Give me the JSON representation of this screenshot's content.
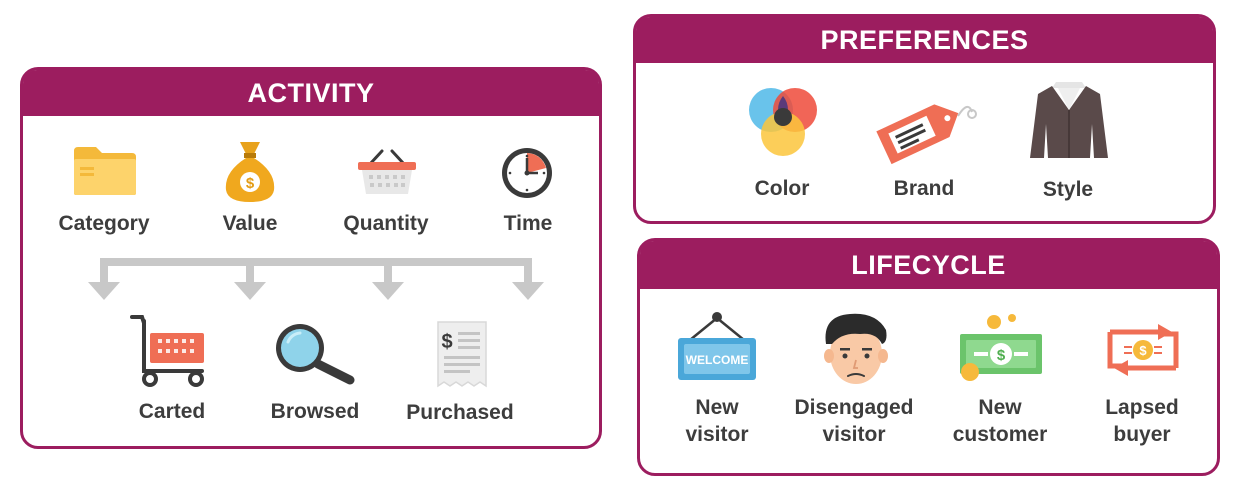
{
  "activity": {
    "title": "ACTIVITY",
    "top_items": [
      {
        "label": "Category",
        "icon": "folder-icon"
      },
      {
        "label": "Value",
        "icon": "money-bag-icon"
      },
      {
        "label": "Quantity",
        "icon": "basket-icon"
      },
      {
        "label": "Time",
        "icon": "clock-icon"
      }
    ],
    "bottom_items": [
      {
        "label": "Carted",
        "icon": "shopping-cart-icon"
      },
      {
        "label": "Browsed",
        "icon": "magnifier-icon"
      },
      {
        "label": "Purchased",
        "icon": "receipt-icon"
      }
    ]
  },
  "preferences": {
    "title": "PREFERENCES",
    "items": [
      {
        "label": "Color",
        "icon": "color-circles-icon"
      },
      {
        "label": "Brand",
        "icon": "tag-icon"
      },
      {
        "label": "Style",
        "icon": "jacket-icon"
      }
    ]
  },
  "lifecycle": {
    "title": "LIFECYCLE",
    "welcome_sign_text": "WELCOME",
    "items": [
      {
        "line1": "New",
        "line2": "visitor",
        "icon": "welcome-sign-icon"
      },
      {
        "line1": "Disengaged",
        "line2": "visitor",
        "icon": "sad-face-icon"
      },
      {
        "line1": "New",
        "line2": "customer",
        "icon": "money-bill-icon"
      },
      {
        "line1": "Lapsed",
        "line2": "buyer",
        "icon": "exchange-icon"
      }
    ]
  },
  "colors": {
    "accent": "#9c1d5f"
  }
}
